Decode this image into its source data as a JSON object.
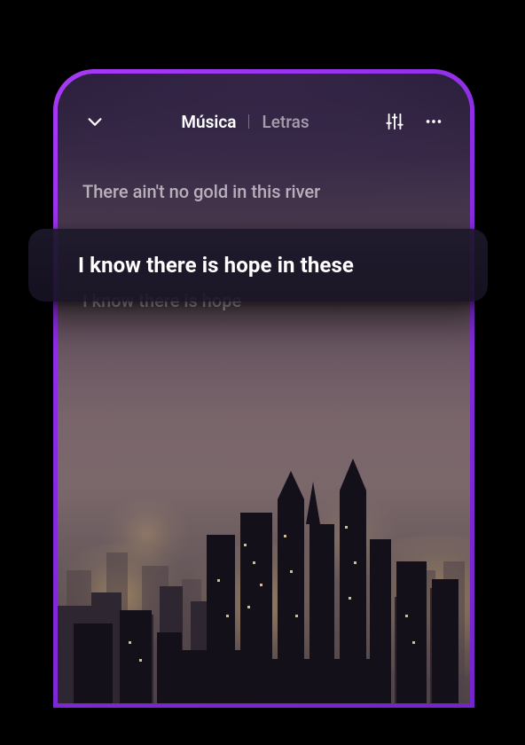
{
  "header": {
    "tabs": {
      "music": "Música",
      "lyrics": "Letras"
    }
  },
  "lyrics": {
    "prev": "There ain't no gold in this river",
    "current": "I know there is hope in these",
    "next": "I know there is hope"
  },
  "colors": {
    "accent": "#a63af6"
  }
}
